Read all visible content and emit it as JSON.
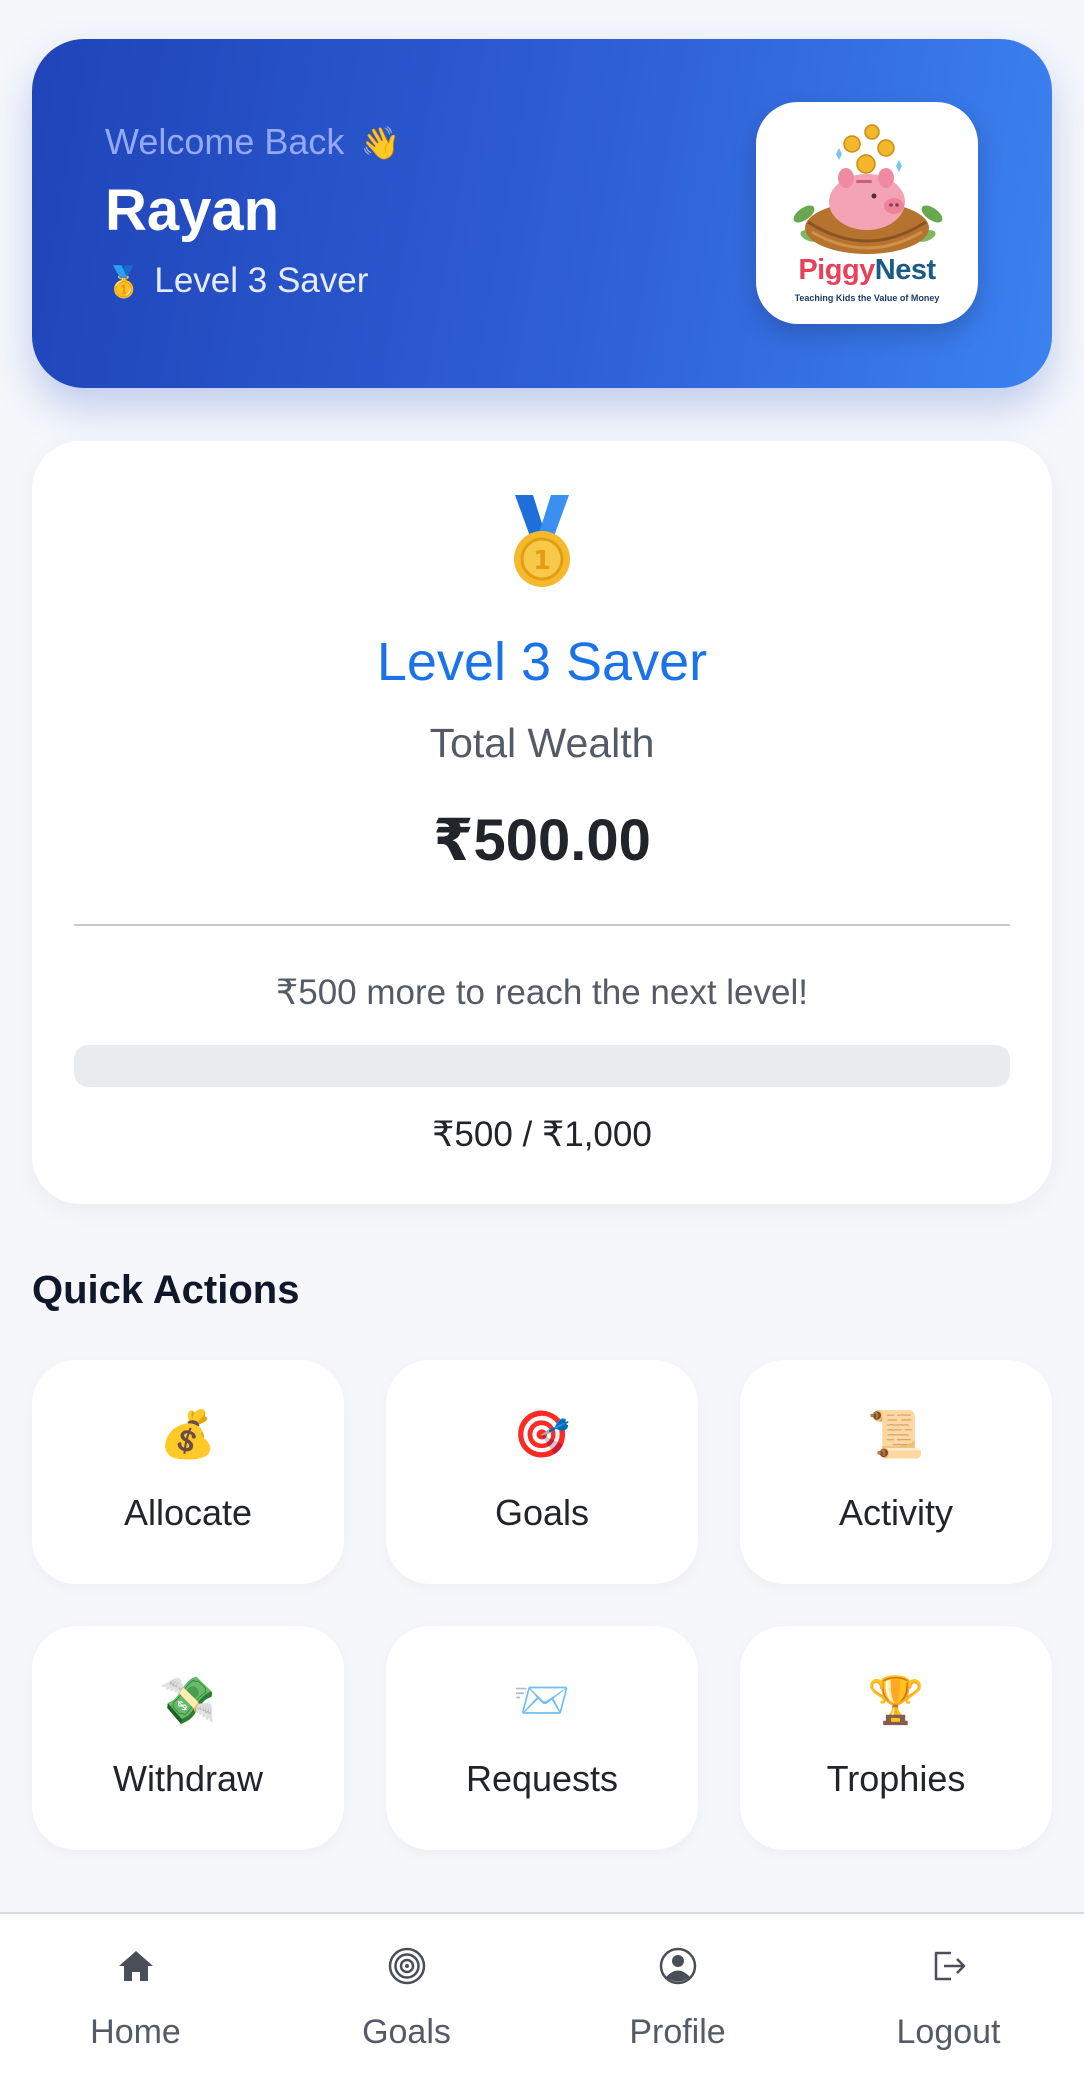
{
  "header": {
    "welcome_text": "Welcome Back",
    "wave_emoji": "👋",
    "user_name": "Rayan",
    "level_emoji": "🥇",
    "level_text": "Level 3 Saver",
    "logo": {
      "brand_part1": "Piggy",
      "brand_part2": "Nest",
      "tagline": "Teaching Kids the Value of Money"
    }
  },
  "wealth_card": {
    "level_title": "Level 3 Saver",
    "total_label": "Total Wealth",
    "total_amount": "₹500.00",
    "next_level_message": "₹500 more to reach the next level!",
    "progress_text": "₹500 / ₹1,000",
    "progress_fraction": 0
  },
  "quick_actions": {
    "title": "Quick Actions",
    "items": [
      {
        "label": "Allocate",
        "emoji": "💰",
        "icon": "money-bag-icon"
      },
      {
        "label": "Goals",
        "emoji": "🎯",
        "icon": "target-icon"
      },
      {
        "label": "Activity",
        "emoji": "📜",
        "icon": "scroll-icon"
      },
      {
        "label": "Withdraw",
        "emoji": "💸",
        "icon": "money-wings-icon"
      },
      {
        "label": "Requests",
        "emoji": "📨",
        "icon": "envelope-icon"
      },
      {
        "label": "Trophies",
        "emoji": "🏆",
        "icon": "trophy-icon"
      }
    ]
  },
  "bottom_nav": {
    "items": [
      {
        "label": "Home",
        "icon": "home-icon"
      },
      {
        "label": "Goals",
        "icon": "target-icon"
      },
      {
        "label": "Profile",
        "icon": "user-circle-icon"
      },
      {
        "label": "Logout",
        "icon": "logout-icon"
      }
    ]
  },
  "colors": {
    "header_gradient_start": "#1f44b8",
    "header_gradient_end": "#3b82f0",
    "accent_blue": "#1a73e8",
    "background": "#f5f7fb"
  }
}
